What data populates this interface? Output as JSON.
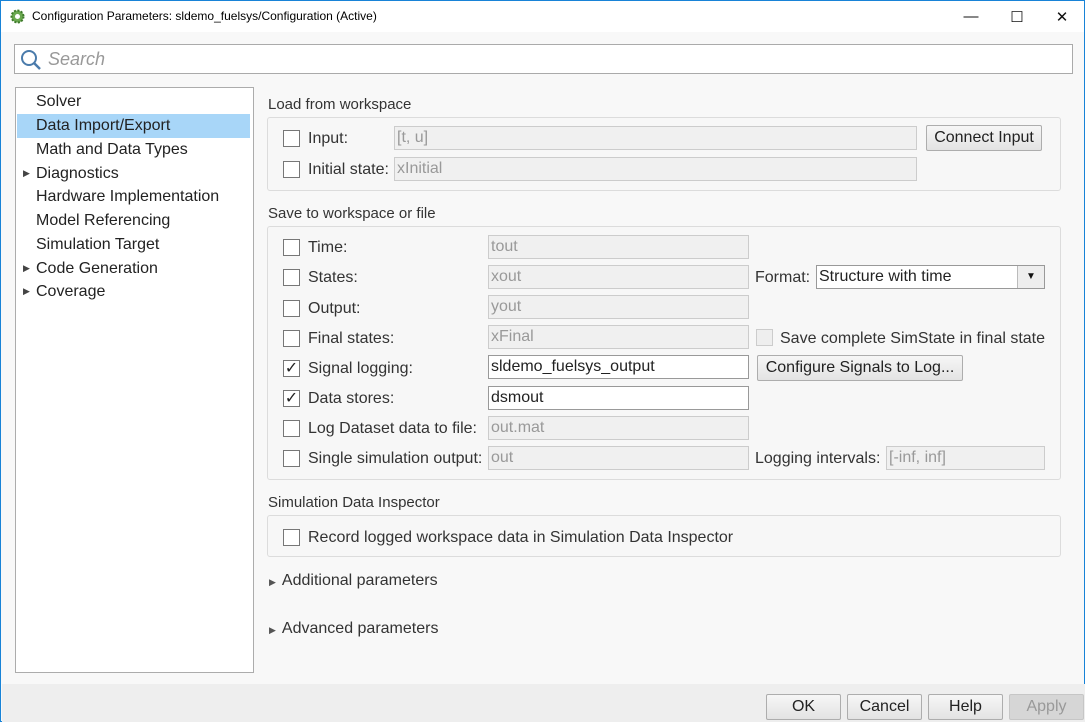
{
  "window": {
    "title": "Configuration Parameters: sldemo_fuelsys/Configuration (Active)",
    "minimize": "—",
    "maximize": "☐",
    "close": "✕"
  },
  "search": {
    "placeholder": "Search"
  },
  "tree": {
    "items": [
      {
        "label": "Solver",
        "expandable": false
      },
      {
        "label": "Data Import/Export",
        "expandable": false,
        "selected": true
      },
      {
        "label": "Math and Data Types",
        "expandable": false
      },
      {
        "label": "Diagnostics",
        "expandable": true
      },
      {
        "label": "Hardware Implementation",
        "expandable": false
      },
      {
        "label": "Model Referencing",
        "expandable": false
      },
      {
        "label": "Simulation Target",
        "expandable": false
      },
      {
        "label": "Code Generation",
        "expandable": true
      },
      {
        "label": "Coverage",
        "expandable": true
      }
    ]
  },
  "load": {
    "title": "Load from workspace",
    "input": {
      "label": "Input:",
      "value": "[t, u]",
      "checked": false
    },
    "initial_state": {
      "label": "Initial state:",
      "value": "xInitial",
      "checked": false
    },
    "connect_button": "Connect Input"
  },
  "save": {
    "title": "Save to workspace or file",
    "rows": [
      {
        "label": "Time:",
        "value": "tout",
        "checked": false,
        "enabled": false
      },
      {
        "label": "States:",
        "value": "xout",
        "checked": false,
        "enabled": false
      },
      {
        "label": "Output:",
        "value": "yout",
        "checked": false,
        "enabled": false
      },
      {
        "label": "Final states:",
        "value": "xFinal",
        "checked": false,
        "enabled": false
      },
      {
        "label": "Signal logging:",
        "value": "sldemo_fuelsys_output",
        "checked": true,
        "enabled": true
      },
      {
        "label": "Data stores:",
        "value": "dsmout",
        "checked": true,
        "enabled": true
      },
      {
        "label": "Log Dataset data to file:",
        "value": "out.mat",
        "checked": false,
        "enabled": false
      },
      {
        "label": "Single simulation output:",
        "value": "out",
        "checked": false,
        "enabled": false
      }
    ],
    "format_label": "Format:",
    "format_value": "Structure with time",
    "simstate_label": "Save complete SimState in final state",
    "configure_button": "Configure Signals to Log...",
    "logging_label": "Logging intervals:",
    "logging_value": "[-inf, inf]"
  },
  "sdi": {
    "title": "Simulation Data Inspector",
    "record_label": "Record logged workspace data in Simulation Data Inspector"
  },
  "additional": "Additional parameters",
  "advanced": "Advanced parameters",
  "buttons": {
    "ok": "OK",
    "cancel": "Cancel",
    "help": "Help",
    "apply": "Apply"
  }
}
